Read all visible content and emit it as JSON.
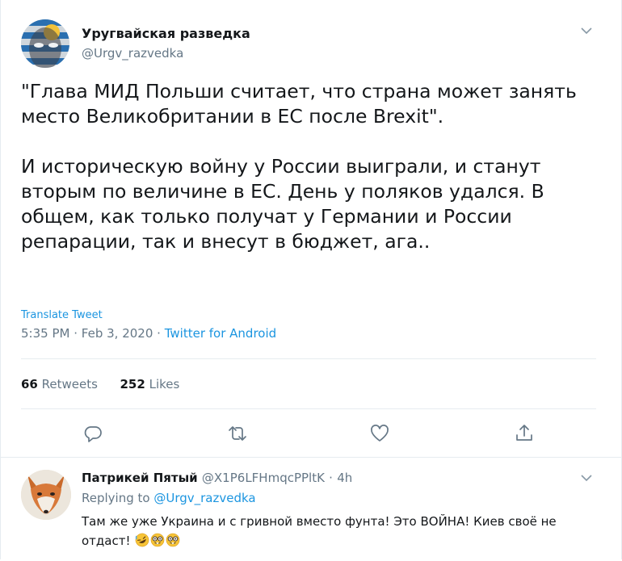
{
  "tweet": {
    "display_name": "Уругвайская разведка",
    "handle": "@Urgv_razvedka",
    "paragraphs": [
      "\"Глава МИД Польши считает, что страна может занять место Великобритании в ЕС после Brexit\".",
      "И историческую войну у России выиграли, и станут вторым по величине в ЕС. День у поляков удался. В общем, как только получат у Германии и России репарации, так и внесут в бюджет, ага.."
    ],
    "translate_label": "Translate Tweet",
    "time": "5:35 PM",
    "date": "Feb 3, 2020",
    "separator": "·",
    "source": "Twitter for Android",
    "retweets_count": "66",
    "retweets_label": "Retweets",
    "likes_count": "252",
    "likes_label": "Likes"
  },
  "reply": {
    "display_name": "Патрикей Пятый",
    "handle": "@X1P6LFHmqcPPltK",
    "separator": "·",
    "age": "4h",
    "replying_label": "Replying to",
    "replying_to": "@Urgv_razvedka",
    "text": "Там же уже Украина и с гривной вместо фунта! Это ВОЙНА! Киев своё не отдаст!",
    "emojis": [
      "rofl-emoji",
      "nerd-face-emoji",
      "nerd-face-emoji"
    ]
  },
  "colors": {
    "link": "#1b95e0",
    "secondary_text": "#657786",
    "primary_text": "#14171a",
    "divider": "#e6ecf0"
  },
  "icons": [
    "chevron-down-icon",
    "reply-icon",
    "retweet-icon",
    "like-icon",
    "share-icon"
  ]
}
